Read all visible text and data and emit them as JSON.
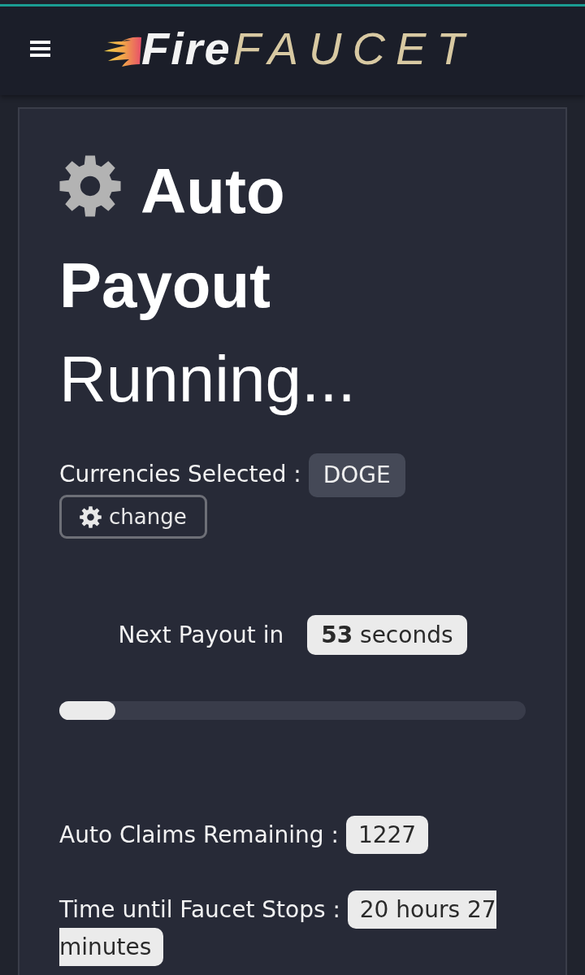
{
  "navbar": {
    "brand": [
      "Fire",
      "FAUCET"
    ]
  },
  "title_lines": [
    "Auto",
    "Payout"
  ],
  "status": "Running...",
  "currencies": {
    "label": "Currencies Selected :",
    "tags": [
      "DOGE"
    ],
    "change_button": "change"
  },
  "next_payout": {
    "label": "Next Payout in",
    "value": "**53** seconds",
    "progress": {
      "level": 0.12
    }
  },
  "stats": [
    {
      "label": "Auto Claims Remaining :",
      "value_lines": [
        "1227"
      ]
    },
    {
      "label": "Time until Faucet Stops :",
      "value_lines": [
        "20 hours 27",
        "minutes"
      ]
    }
  ]
}
